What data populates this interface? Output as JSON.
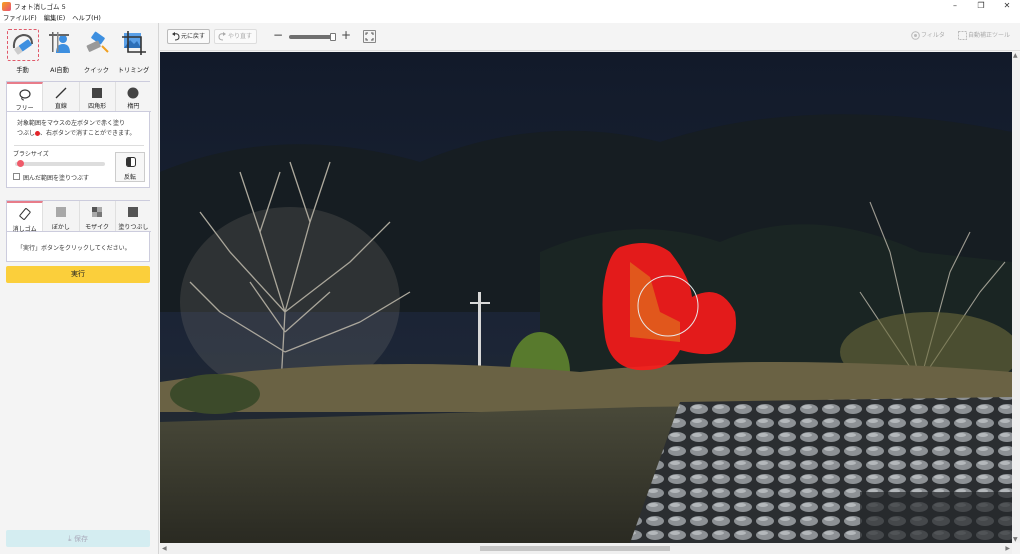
{
  "window": {
    "title": "フォト消しゴム 5",
    "controls": [
      "–",
      "❐",
      "✕"
    ]
  },
  "menu": {
    "items": [
      "ファイル(F)",
      "編集(E)",
      "ヘルプ(H)"
    ]
  },
  "modes": [
    {
      "label": "手動",
      "icon": "hand-eraser-icon",
      "active": true
    },
    {
      "label": "AI自動",
      "icon": "ai-auto-icon",
      "active": false
    },
    {
      "label": "クイック",
      "icon": "quick-icon",
      "active": false
    },
    {
      "label": "トリミング",
      "icon": "trim-icon",
      "active": false
    }
  ],
  "select_tools": [
    {
      "label": "フリー",
      "icon": "lasso-icon",
      "selected": true
    },
    {
      "label": "直線",
      "icon": "line-icon",
      "selected": false
    },
    {
      "label": "四角形",
      "icon": "rectangle-icon",
      "selected": false
    },
    {
      "label": "楕円",
      "icon": "ellipse-icon",
      "selected": false
    }
  ],
  "instructions": {
    "line1": "対象範囲をマウスの左ボタンで赤く塗り",
    "line2a": "つぶし",
    "line2b": "、右ボタンで消すことができます。"
  },
  "brush": {
    "label": "ブラシサイズ",
    "value_fraction": 0.05,
    "fill_label": "囲んだ範囲を塗りつぶす",
    "fill_checked": false,
    "invert_label": "反転"
  },
  "actions": [
    {
      "label": "消しゴム",
      "icon": "eraser-icon",
      "selected": true
    },
    {
      "label": "ぼかし",
      "icon": "blur-icon",
      "selected": false
    },
    {
      "label": "モザイク",
      "icon": "mosaic-icon",
      "selected": false
    },
    {
      "label": "塗りつぶし",
      "icon": "fill-icon",
      "selected": false
    }
  ],
  "action_message": "「実行」ボタンをクリックしてください。",
  "run_label": "実行",
  "save_label": "保存",
  "toolbar": {
    "undo_label": "元に戻す",
    "redo_label": "やり直す",
    "zoom_minus": "−",
    "zoom_plus": "+",
    "filter_label": "フィルタ",
    "auto_correct_label": "自動補正ツール"
  },
  "colors": {
    "accent_pink": "#e05a6a",
    "run_yellow": "#fbcf3b",
    "mask_red": "#ff1a1a"
  }
}
